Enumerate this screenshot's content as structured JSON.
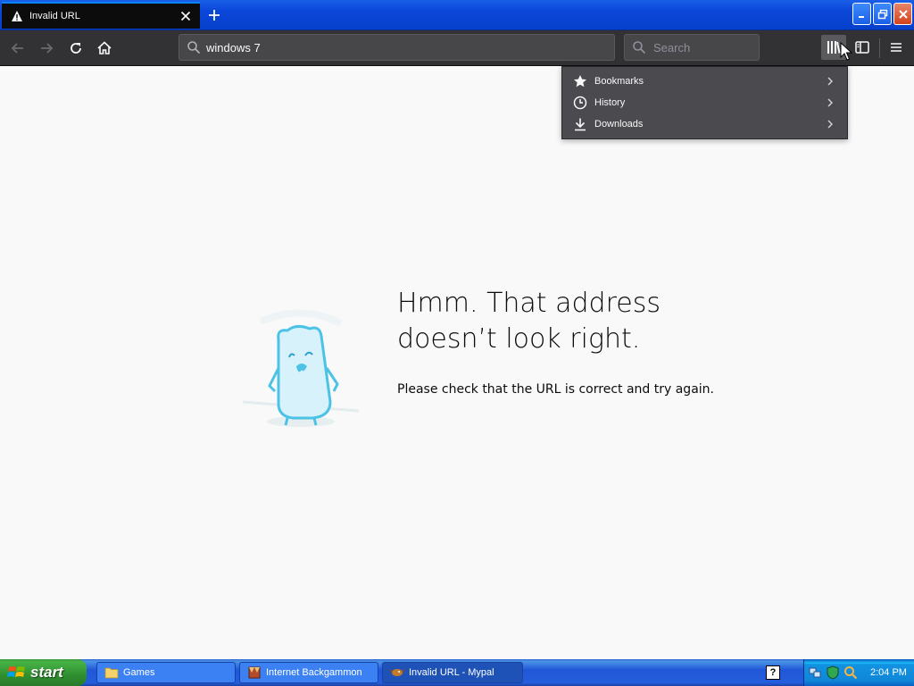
{
  "tab": {
    "title": "Invalid URL"
  },
  "toolbar": {
    "url_value": "windows 7",
    "search_placeholder": "Search"
  },
  "library_menu": {
    "items": [
      {
        "label": "Bookmarks",
        "icon": "star-icon"
      },
      {
        "label": "History",
        "icon": "clock-icon"
      },
      {
        "label": "Downloads",
        "icon": "download-icon"
      }
    ]
  },
  "error_page": {
    "title_line1": "Hmm. That address",
    "title_line2": "doesn’t look right.",
    "message": "Please check that the URL is correct and try again."
  },
  "taskbar": {
    "start_label": "start",
    "tasks": [
      {
        "label": "Games",
        "icon": "folder-icon"
      },
      {
        "label": "Internet Backgammon",
        "icon": "backgammon-icon"
      },
      {
        "label": "Invalid URL - Mypal",
        "icon": "mypal-icon"
      }
    ],
    "clock": "2:04 PM"
  },
  "colors": {
    "titlebar_blue": "#0a46d8",
    "toolbar_dark": "#323234",
    "menu_gray": "#4a4a4f",
    "taskbar_blue": "#245edc",
    "start_green": "#3c9a3c"
  }
}
